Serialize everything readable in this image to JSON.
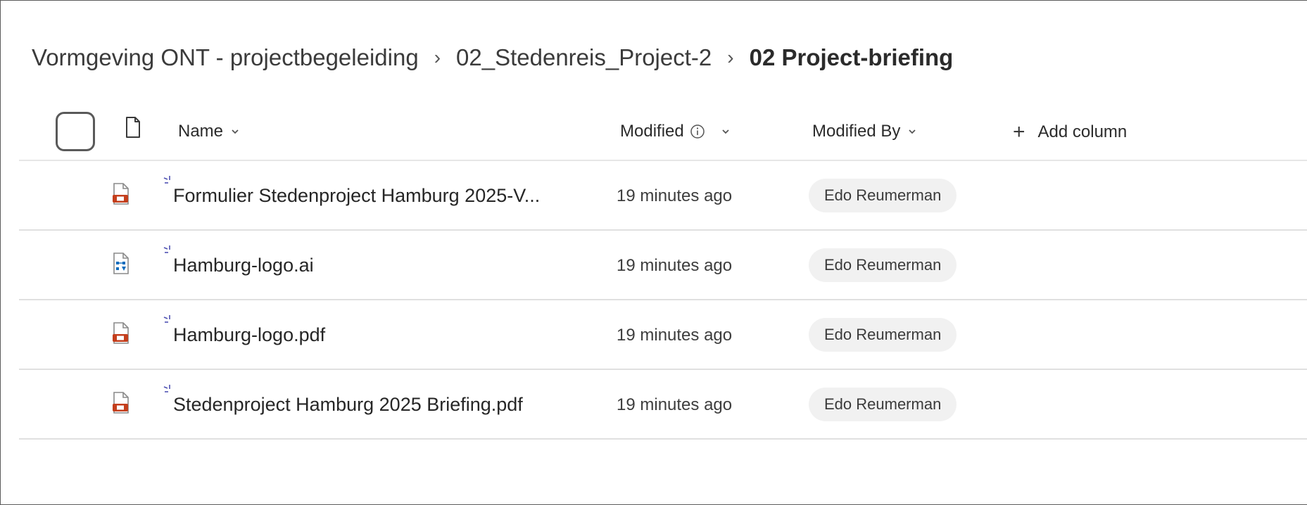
{
  "breadcrumb": {
    "items": [
      {
        "label": "Vormgeving ONT - projectbegeleiding"
      },
      {
        "label": "02_Stedenreis_Project-2"
      },
      {
        "label": "02 Project-briefing"
      }
    ],
    "separator": "›"
  },
  "header": {
    "name_label": "Name",
    "modified_label": "Modified",
    "modified_by_label": "Modified By",
    "add_column_label": "Add column",
    "add_column_icon": "+"
  },
  "files": [
    {
      "name": "Formulier Stedenproject Hamburg 2025-V...",
      "type": "pdf",
      "modified": "19 minutes ago",
      "modified_by": "Edo Reumerman"
    },
    {
      "name": "Hamburg-logo.ai",
      "type": "vector",
      "modified": "19 minutes ago",
      "modified_by": "Edo Reumerman"
    },
    {
      "name": "Hamburg-logo.pdf",
      "type": "pdf",
      "modified": "19 minutes ago",
      "modified_by": "Edo Reumerman"
    },
    {
      "name": "Stedenproject Hamburg 2025 Briefing.pdf",
      "type": "pdf",
      "modified": "19 minutes ago",
      "modified_by": "Edo Reumerman"
    }
  ],
  "colors": {
    "pdf_icon": "#c43e1c",
    "vector_icon": "#0f6cbd",
    "new_mark": "#4f52b2"
  }
}
